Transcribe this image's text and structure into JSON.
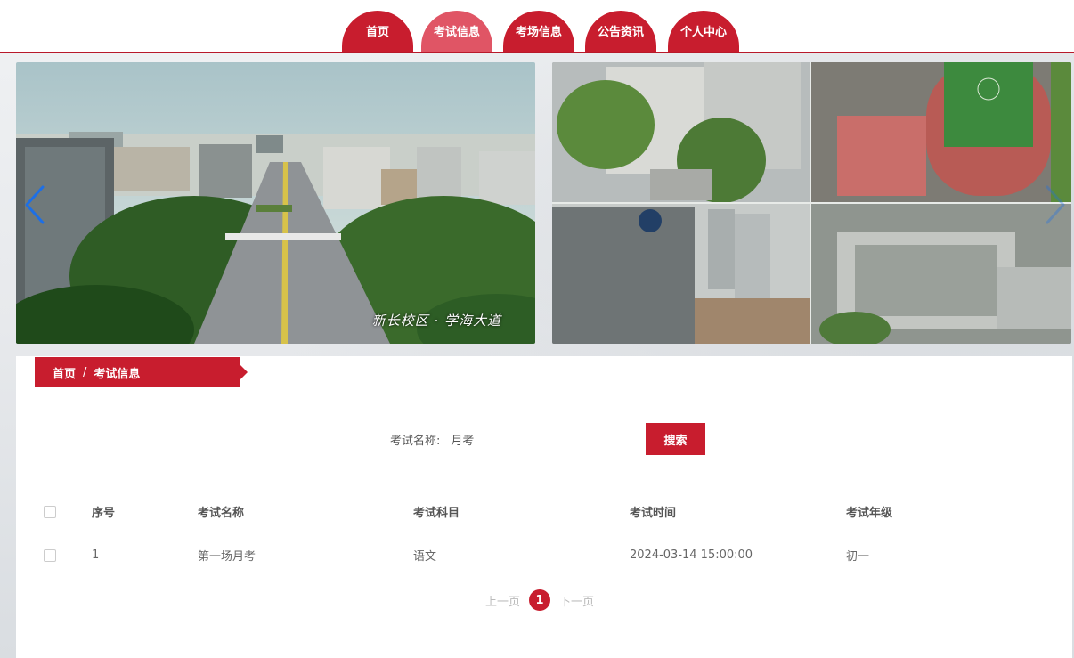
{
  "nav": {
    "items": [
      {
        "label": "首页"
      },
      {
        "label": "考试信息"
      },
      {
        "label": "考场信息"
      },
      {
        "label": "公告资讯"
      },
      {
        "label": "个人中心"
      }
    ],
    "active_index": 1
  },
  "banner": {
    "caption": "新长校区 · 学海大道",
    "prev_icon": "chevron-left-icon",
    "next_icon": "chevron-right-icon"
  },
  "breadcrumb": {
    "home": "首页",
    "separator": "/",
    "current": "考试信息"
  },
  "search": {
    "label": "考试名称:",
    "value": "月考",
    "button": "搜索"
  },
  "table": {
    "headers": [
      "序号",
      "考试名称",
      "考试科目",
      "考试时间",
      "考试年级"
    ],
    "rows": [
      [
        "1",
        "第一场月考",
        "语文",
        "2024-03-14 15:00:00",
        "初一"
      ]
    ]
  },
  "pager": {
    "prev": "上一页",
    "current": "1",
    "next": "下一页"
  },
  "colors": {
    "accent": "#c81d2e",
    "accent_active": "#e05565"
  }
}
